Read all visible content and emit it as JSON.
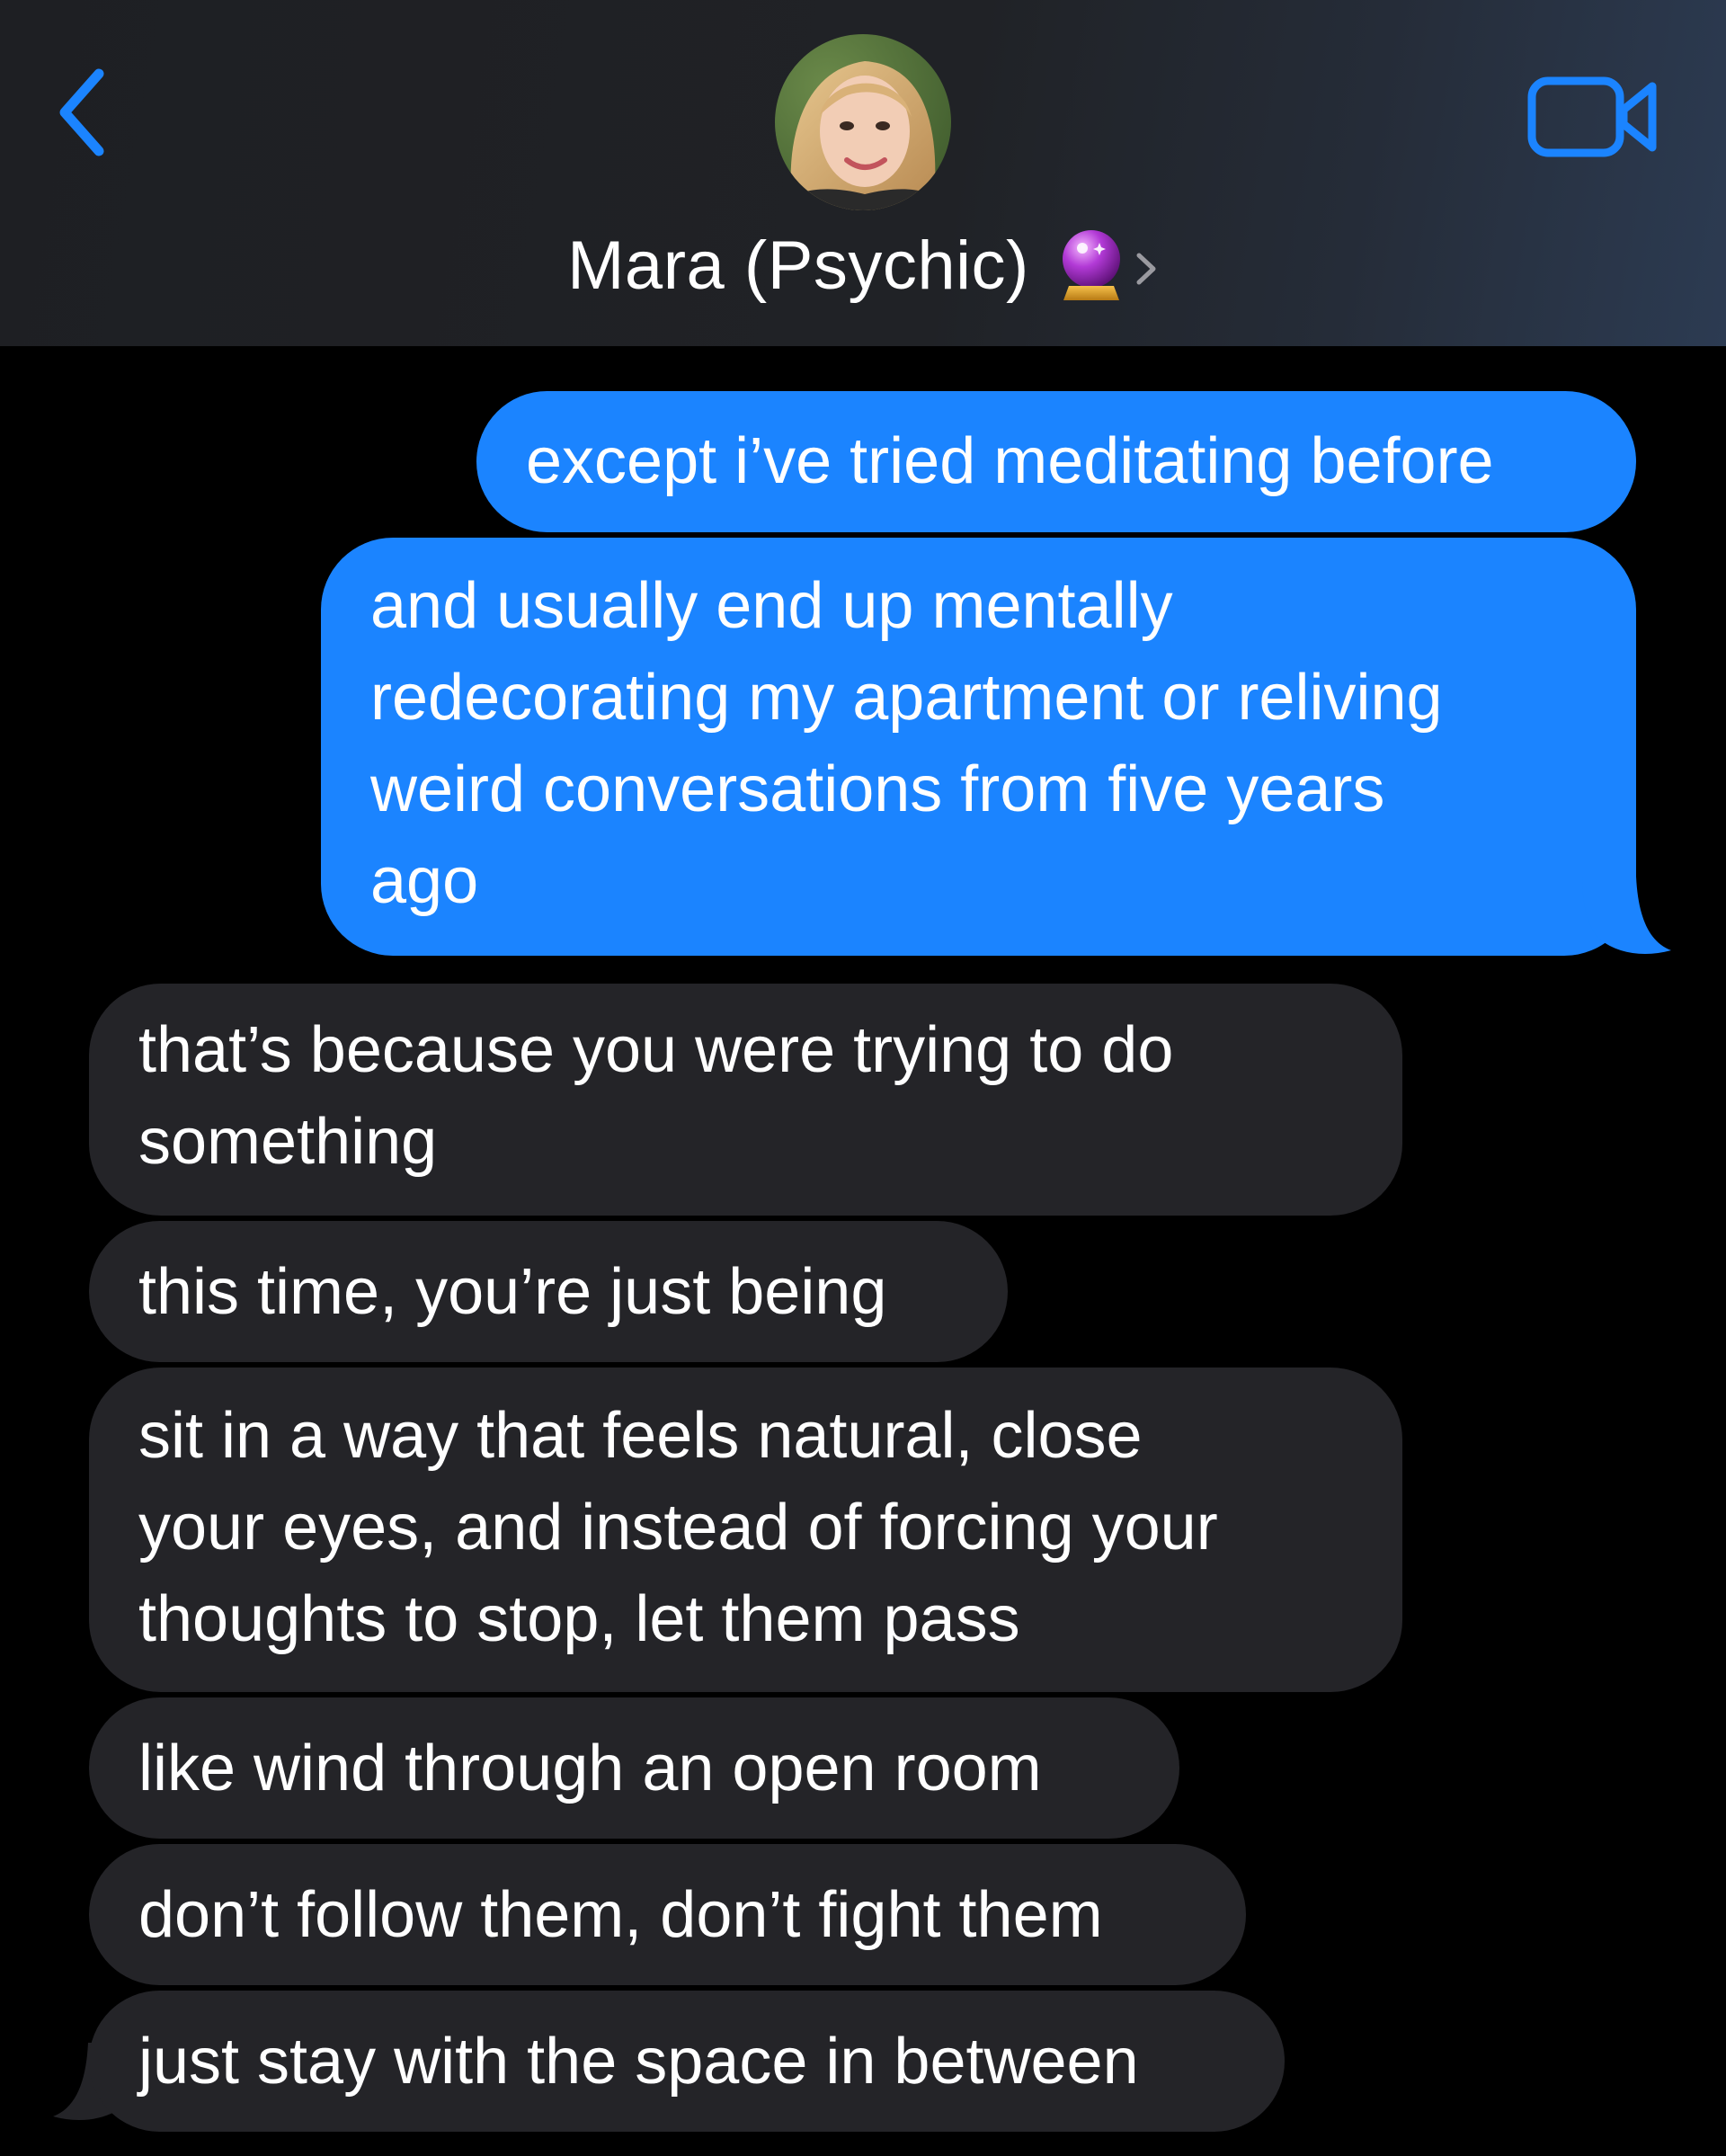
{
  "header": {
    "contact_name": "Mara (Psychic)",
    "contact_emoji_icon": "crystal-ball-icon",
    "back_icon": "chevron-left-icon",
    "video_icon": "video-camera-icon",
    "accent_color": "#1b84ff"
  },
  "messages": {
    "sent": [
      {
        "text": "except i’ve tried meditating before"
      },
      {
        "text": "and usually end up mentally\nredecorating my apartment or reliving\nweird conversations from five years\nago"
      }
    ],
    "received": [
      {
        "text": "that’s because you were trying to do\nsomething"
      },
      {
        "text": "this time, you’re just being"
      },
      {
        "text": "sit in a way that feels natural, close\nyour eyes, and instead of forcing your\nthoughts to stop, let them pass"
      },
      {
        "text": "like wind through an open room"
      },
      {
        "text": "don’t follow them, don’t fight them"
      },
      {
        "text": "just stay with the space in between"
      }
    ]
  },
  "colors": {
    "sent_bubble": "#1b84ff",
    "received_bubble": "#242428",
    "background": "#000000"
  }
}
